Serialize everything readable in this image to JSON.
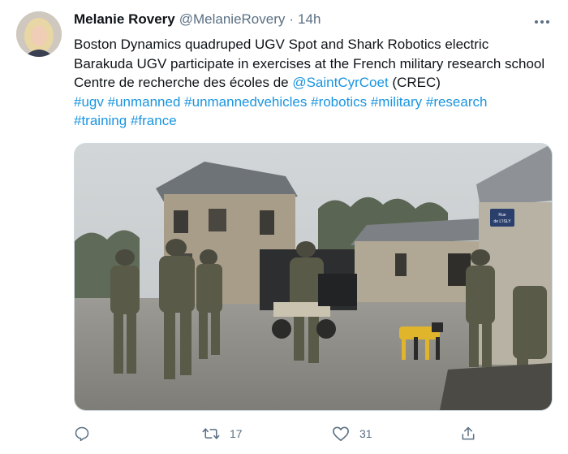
{
  "tweet": {
    "author_name": "Melanie Rovery",
    "author_handle": "@MelanieRovery",
    "separator": "·",
    "timestamp": "14h",
    "text_lines": {
      "l1": "Boston Dynamics quadruped UGV Spot and Shark Robotics electric",
      "l2": "Barakuda UGV participate in exercises at the French military research school",
      "l3_prefix": "Centre de recherche des écoles de ",
      "l3_mention": "@SaintCyrCoet",
      "l3_suffix": " (CREC)"
    },
    "hashtags": [
      "#ugv",
      "#unmanned",
      "#unmannedvehicles",
      "#robotics",
      "#military",
      "#research",
      "#training",
      "#france"
    ],
    "media": {
      "street_sign_line1": "Rue",
      "street_sign_line2": "de L'ISLY"
    },
    "actions": {
      "reply_icon": "reply-icon",
      "retweet_icon": "retweet-icon",
      "retweet_count": "17",
      "like_icon": "heart-icon",
      "like_count": "31",
      "share_icon": "share-icon"
    },
    "colors": {
      "link": "#1b95e0",
      "secondary_text": "#5b7083",
      "primary_text": "#0f1419"
    }
  }
}
